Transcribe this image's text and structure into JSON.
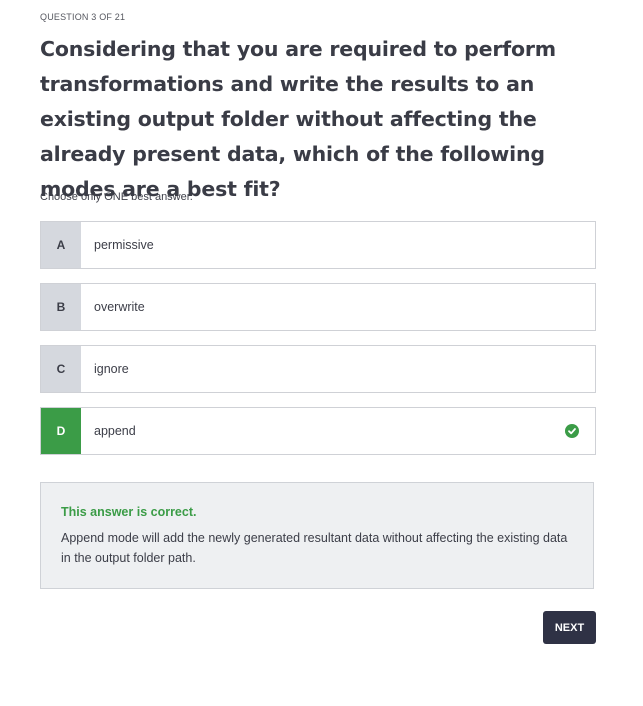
{
  "header": {
    "question_number": "QUESTION 3 OF 21"
  },
  "question": {
    "text": "Considering that you are required to perform transformations and write the results to an existing output folder without affecting the already present data, which of the following modes are a best fit?",
    "instruction": "Choose only ONE best answer."
  },
  "options": [
    {
      "letter": "A",
      "label": "permissive",
      "selected": false
    },
    {
      "letter": "B",
      "label": "overwrite",
      "selected": false
    },
    {
      "letter": "C",
      "label": "ignore",
      "selected": false
    },
    {
      "letter": "D",
      "label": "append",
      "selected": true
    }
  ],
  "feedback": {
    "title": "This answer is correct.",
    "text": "Append mode will add the newly generated resultant data without affecting the existing data in the output folder path."
  },
  "actions": {
    "next_label": "NEXT"
  },
  "colors": {
    "correct": "#3b9c47",
    "letter_bg": "#d5d8de",
    "button_bg": "#2f3245",
    "feedback_bg": "#eef0f2"
  }
}
